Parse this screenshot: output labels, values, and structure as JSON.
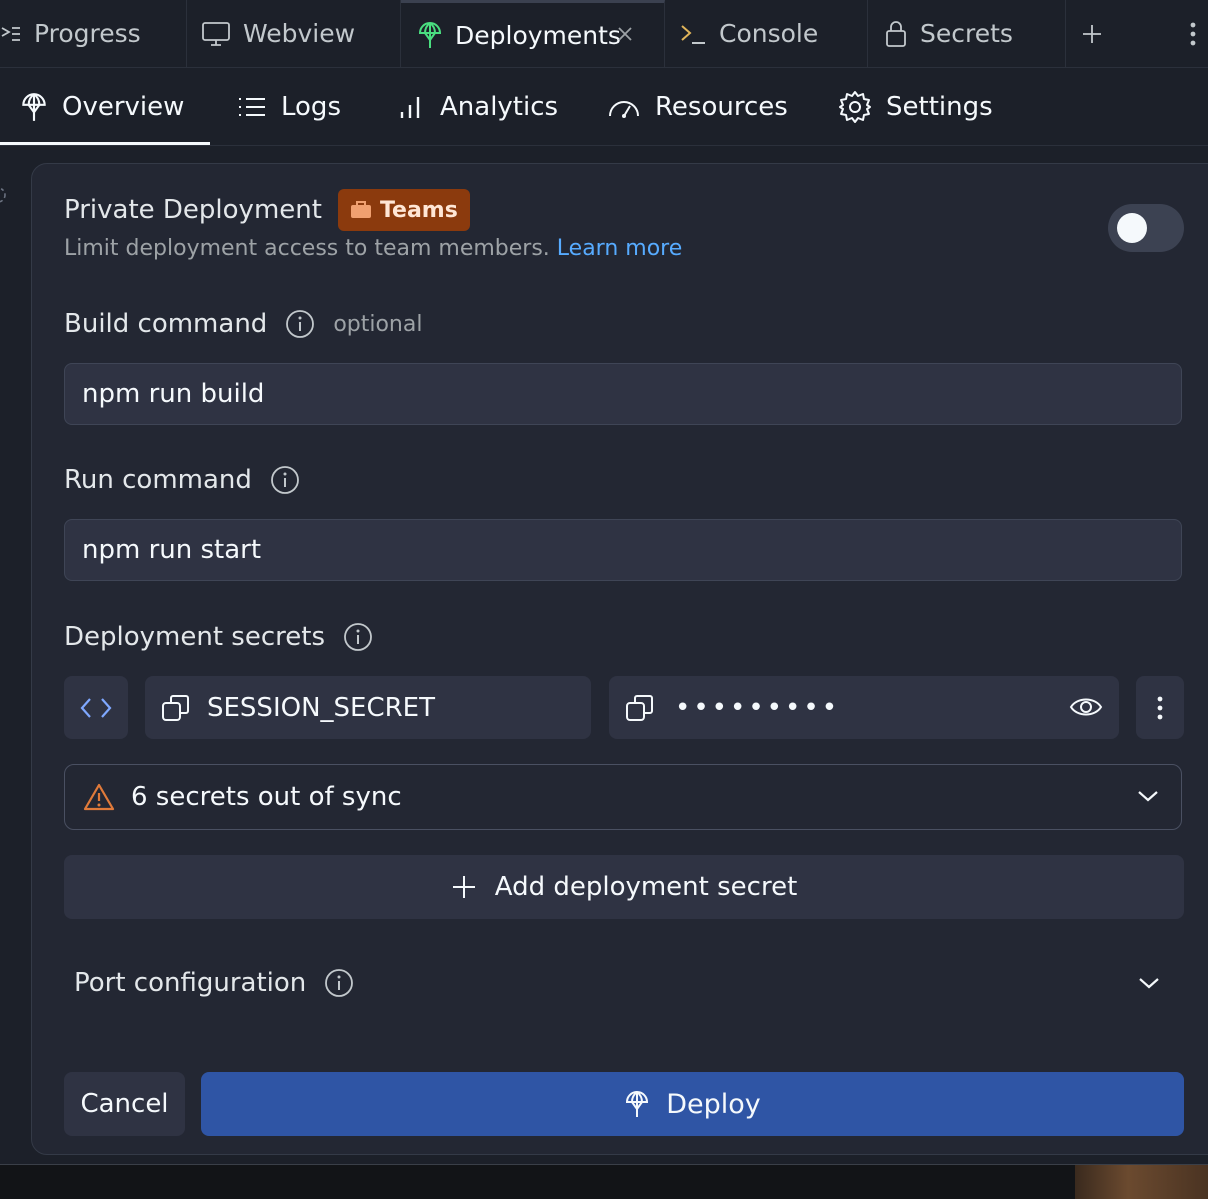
{
  "tabs": [
    {
      "label": "Progress",
      "icon": "progress-icon"
    },
    {
      "label": "Webview",
      "icon": "monitor-icon"
    },
    {
      "label": "Deployments",
      "icon": "deployments-icon",
      "active": true
    },
    {
      "label": "Console",
      "icon": "terminal-icon"
    },
    {
      "label": "Secrets",
      "icon": "lock-icon"
    }
  ],
  "subnav": [
    {
      "label": "Overview",
      "icon": "deployments-icon",
      "active": true
    },
    {
      "label": "Logs",
      "icon": "list-icon"
    },
    {
      "label": "Analytics",
      "icon": "bar-chart-icon"
    },
    {
      "label": "Resources",
      "icon": "gauge-icon"
    },
    {
      "label": "Settings",
      "icon": "gear-icon"
    }
  ],
  "private": {
    "title": "Private Deployment",
    "badge": "Teams",
    "description": "Limit deployment access to team members.",
    "learn_more": "Learn more",
    "enabled": false
  },
  "build": {
    "label": "Build command",
    "optional": "optional",
    "value": "npm run build"
  },
  "run": {
    "label": "Run command",
    "value": "npm run start"
  },
  "secrets": {
    "label": "Deployment secrets",
    "key": "SESSION_SECRET",
    "value_masked": "•••••••••",
    "out_of_sync": "6 secrets out of sync",
    "add": "Add deployment secret"
  },
  "port": {
    "label": "Port configuration"
  },
  "actions": {
    "cancel": "Cancel",
    "deploy": "Deploy"
  },
  "colors": {
    "accent": "#2f55a5",
    "badge": "#8b3a0d",
    "warning": "#e07a3a",
    "link": "#57abff",
    "deploy_icon": "#4ade80"
  }
}
